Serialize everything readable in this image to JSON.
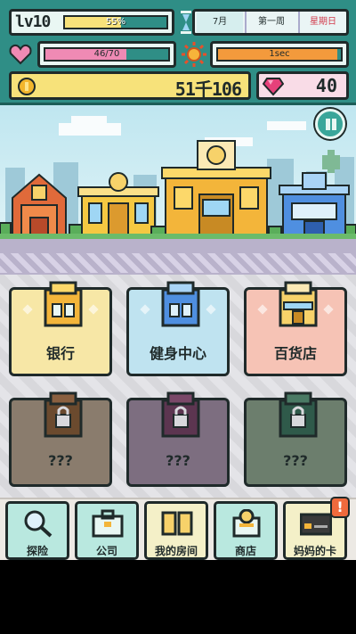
{
  "hud": {
    "level": "lv10",
    "xp_percent": "55%",
    "xp_fraction": 0.55,
    "date": {
      "month": "7月",
      "week": "第一周",
      "weekday": "星期日"
    },
    "health": {
      "text": "46/70",
      "current": 46,
      "max": 70
    },
    "timer": {
      "text": "1sec",
      "fraction": 0.97
    },
    "money": "51千106",
    "gems": "40"
  },
  "buildings": [
    {
      "label": "银行",
      "locked": false,
      "icon": "bank-building-icon"
    },
    {
      "label": "健身中心",
      "locked": false,
      "icon": "gym-building-icon"
    },
    {
      "label": "百货店",
      "locked": false,
      "icon": "store-building-icon"
    },
    {
      "label": "???",
      "locked": true,
      "icon": "locked-building-icon"
    },
    {
      "label": "???",
      "locked": true,
      "icon": "locked-building-icon"
    },
    {
      "label": "???",
      "locked": true,
      "icon": "locked-building-icon"
    }
  ],
  "nav": {
    "explore": "探险",
    "company": "公司",
    "room": "我的房间",
    "shop": "商店",
    "card": "妈妈的卡",
    "card_badge": "!"
  },
  "colors": {
    "hud_bg": "#2f8e86",
    "xp_fill": "#f7e27a",
    "hp_fill": "#ef8ab4",
    "timer_fill": "#f39a3c",
    "weekday": "#d23b4c"
  }
}
